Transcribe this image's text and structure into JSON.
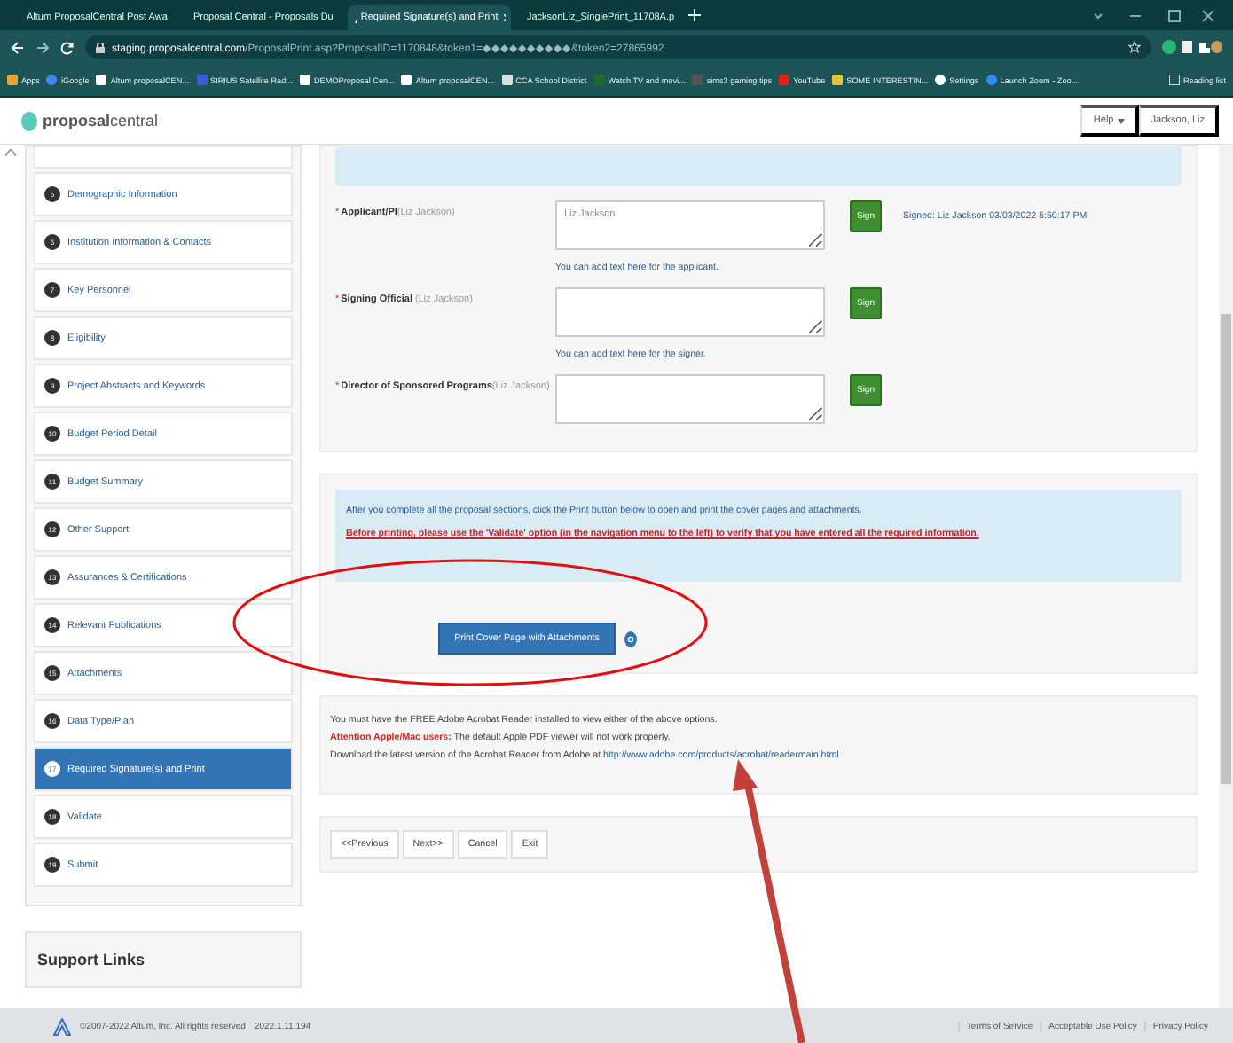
{
  "browser": {
    "tabs": [
      {
        "label": "Altum ProposalCentral Post Awa",
        "kind": "site",
        "selected": false
      },
      {
        "label": "Proposal Central - Proposals Du",
        "kind": "site",
        "selected": false
      },
      {
        "label": "Required Signature(s) and Print",
        "kind": "site",
        "selected": true
      },
      {
        "label": "JacksonLiz_SinglePrint_11708A.p",
        "kind": "pdf",
        "selected": false
      }
    ],
    "url_host": "staging.proposalcentral.com",
    "url_path": "/ProposalPrint.asp?ProposalID=1170848&token1=◆◆◆◆◆◆◆◆◆◆&token2=27865992",
    "bookmarks": [
      {
        "label": "Apps",
        "kind": "apps"
      },
      {
        "label": "iGoogle",
        "kind": "google"
      },
      {
        "label": "Altum proposalCEN...",
        "kind": "altum"
      },
      {
        "label": "SIRIUS Satellite Rad...",
        "kind": "sirius"
      },
      {
        "label": "DEMOProposal Cen...",
        "kind": "altum"
      },
      {
        "label": "Altum proposalCEN...",
        "kind": "altum"
      },
      {
        "label": "CCA School District",
        "kind": "school"
      },
      {
        "label": "Watch TV and movi...",
        "kind": "tv"
      },
      {
        "label": "sims3 gaming tips",
        "kind": "game"
      },
      {
        "label": "YouTube",
        "kind": "youtube"
      },
      {
        "label": "SOME INTERESTIN...",
        "kind": "folder"
      },
      {
        "label": "Settings",
        "kind": "gear"
      },
      {
        "label": "Launch Zoom - Zoo...",
        "kind": "zoom"
      }
    ],
    "reading_list": "Reading list"
  },
  "header": {
    "logo": "**proposal**central",
    "help": "Help",
    "user": "Jackson, Liz"
  },
  "sidebar": {
    "items": [
      {
        "number": "5",
        "label": "Demographic Information",
        "selected": false
      },
      {
        "number": "6",
        "label": "Institution Information & Contacts",
        "selected": false
      },
      {
        "number": "7",
        "label": "Key Personnel",
        "selected": false
      },
      {
        "number": "8",
        "label": "Eligibility",
        "selected": false
      },
      {
        "number": "9",
        "label": "Project Abstracts and Keywords",
        "selected": false
      },
      {
        "number": "10",
        "label": "Budget Period Detail",
        "selected": false
      },
      {
        "number": "11",
        "label": "Budget Summary",
        "selected": false
      },
      {
        "number": "12",
        "label": "Other Support",
        "selected": false
      },
      {
        "number": "13",
        "label": "Assurances & Certifications",
        "selected": false
      },
      {
        "number": "14",
        "label": "Relevant Publications",
        "selected": false
      },
      {
        "number": "15",
        "label": "Attachments",
        "selected": false
      },
      {
        "number": "16",
        "label": "Data Type/Plan",
        "selected": false
      },
      {
        "number": "17",
        "label": "Required Signature(s) and Print",
        "selected": true
      },
      {
        "number": "18",
        "label": "Validate",
        "selected": false
      },
      {
        "number": "19",
        "label": "Submit",
        "selected": false
      }
    ],
    "support_title": "Support Links"
  },
  "signatures": [
    {
      "marker": "*",
      "label": "**Applicant/PI**(Liz Jackson)",
      "value": "Liz Jackson",
      "hint": "You can add text here for the applicant.",
      "button": "Sign",
      "status": "Signed: Liz Jackson 03/03/2022 5:50:17 PM"
    },
    {
      "marker": "*",
      "label": "**Signing Official** (Liz Jackson)",
      "hint": "You can add text here for the signer.",
      "button": "Sign"
    },
    {
      "marker": "*",
      "label": "**Director of Sponsored Programs**(Liz Jackson)",
      "button": "Sign"
    }
  ],
  "print_panel": {
    "info": "After you complete all the proposal sections, click the Print button below to open and print the cover pages and attachments.",
    "warning": "Before printing, please use the 'Validate' option (in the navigation menu to the left) to verify that you have entered all the required information.",
    "button": "Print Cover Page with Attachments"
  },
  "notice": {
    "line1": "You must have the FREE Adobe Acrobat Reader installed to view either of the above options.",
    "attention_label": "Attention Apple/Mac users:",
    "attention_text": "The default Apple PDF viewer will not work properly.",
    "download_text": "Download the latest version of the Acrobat Reader from Adobe at",
    "link": "http://www.adobe.com/products/acrobat/readermain.html"
  },
  "nav_buttons": [
    "<<Previous",
    "Next>>",
    "Cancel",
    "Exit"
  ],
  "footer": {
    "copyright": "©2007-2022 Altum, Inc. All rights reserved",
    "version": "2022.1.11.194",
    "links": [
      "Terms of Service",
      "Acceptable Use Policy",
      "Privacy Policy"
    ]
  }
}
